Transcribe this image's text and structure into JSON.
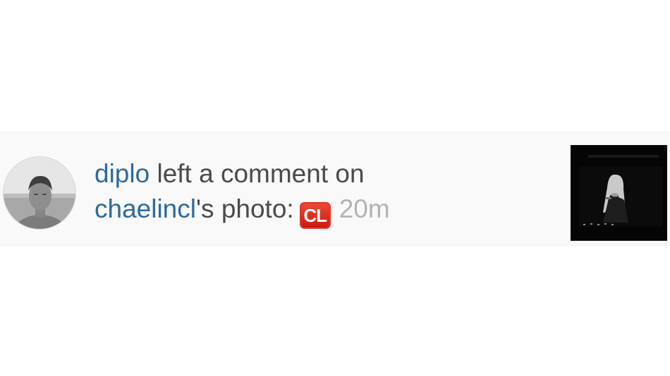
{
  "notification": {
    "actor_username": "diplo",
    "action_text": " left a comment on",
    "target_username": "chaelincl",
    "target_suffix": "'s photo:",
    "comment_emoji": "CL",
    "timestamp": "20m",
    "avatar_icon": "user-avatar-icon",
    "thumbnail_icon": "photo-thumbnail-icon"
  },
  "colors": {
    "username": "#2d6a9f",
    "body_text": "#4a4a4a",
    "timestamp": "#b3b3b3",
    "row_background": "#f9f9f9",
    "emoji_red": "#e23527"
  }
}
